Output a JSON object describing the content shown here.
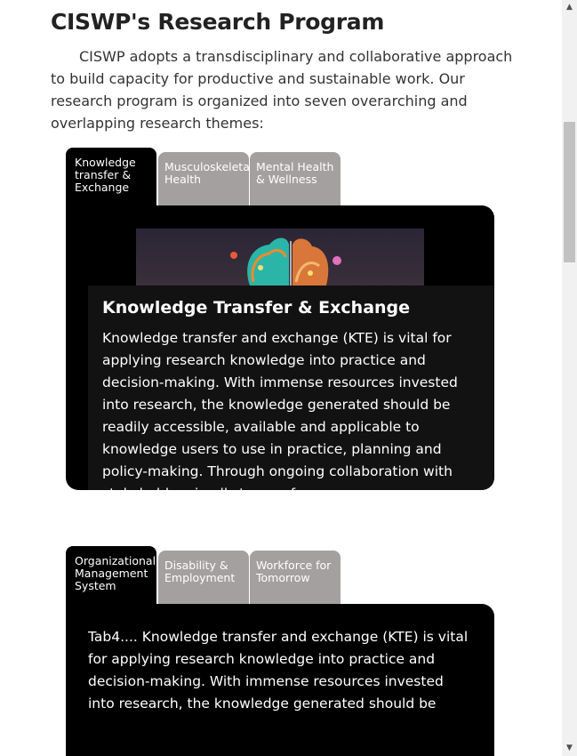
{
  "page": {
    "title": "CISWP's Research Program",
    "intro": "CISWP adopts a transdisciplinary and collaborative approach to build capacity for productive and sustainable work. Our research program is organized into seven overarching and overlapping research themes:"
  },
  "tabset1": {
    "tabs": [
      {
        "label": "Knowledge transfer & Exchange",
        "active": true
      },
      {
        "label": "Musculoskeletal Health",
        "active": false
      },
      {
        "label": "Mental Health & Wellness",
        "active": false
      }
    ],
    "panel": {
      "image_icon": "brain-illustration",
      "heading": "Knowledge Transfer & Exchange",
      "body": "Knowledge transfer and exchange (KTE) is vital for applying research knowledge into practice and decision-making. With immense resources invested into research, the knowledge generated should be readily accessible, available and applicable to knowledge users to use in practice, planning and policy-making. Through ongoing collaboration with stakeholders in all stages of"
    }
  },
  "tabset2": {
    "tabs": [
      {
        "label": "Organizational Management System",
        "active": true
      },
      {
        "label": "Disability & Employment",
        "active": false
      },
      {
        "label": "Workforce for Tomorrow",
        "active": false
      }
    ],
    "panel": {
      "body": "Tab4.... Knowledge transfer and exchange (KTE) is vital for applying research knowledge into practice and decision-making. With immense resources invested into research, the knowledge generated should be"
    }
  },
  "colors": {
    "tab_inactive": "#a5a0a0",
    "tab_active": "#000000",
    "panel_bg": "#000000",
    "text_dark": "#222222"
  }
}
